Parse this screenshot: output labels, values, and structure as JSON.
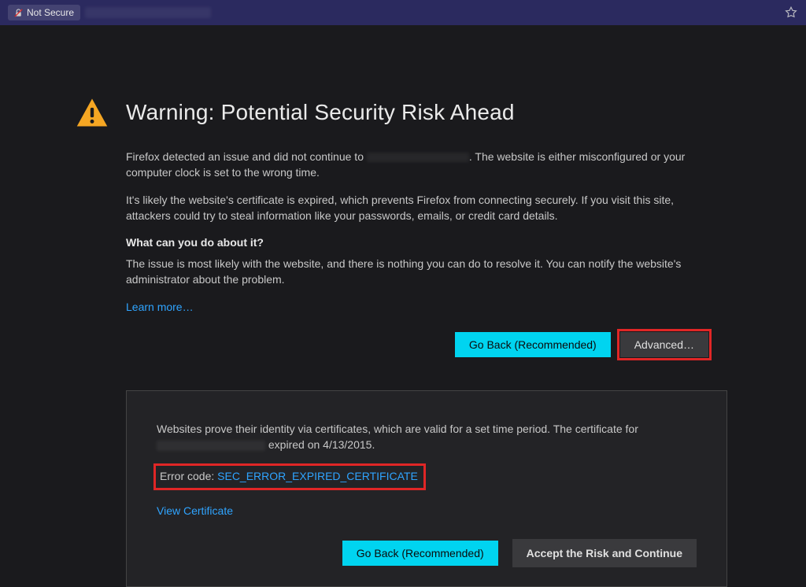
{
  "address_bar": {
    "not_secure_label": "Not Secure"
  },
  "page": {
    "title": "Warning: Potential Security Risk Ahead",
    "para1_before": "Firefox detected an issue and did not continue to ",
    "para1_after": ". The website is either misconfigured or your computer clock is set to the wrong time.",
    "para2": "It's likely the website's certificate is expired, which prevents Firefox from connecting securely. If you visit this site, attackers could try to steal information like your passwords, emails, or credit card details.",
    "subhead": "What can you do about it?",
    "para3": "The issue is most likely with the website, and there is nothing you can do to resolve it. You can notify the website's administrator about the problem.",
    "learn_more": "Learn more…",
    "go_back_label": "Go Back (Recommended)",
    "advanced_label": "Advanced…"
  },
  "panel": {
    "text_before": "Websites prove their identity via certificates, which are valid for a set time period. The certificate for ",
    "text_after": " expired on 4/13/2015.",
    "error_code_label": "Error code: ",
    "error_code": "SEC_ERROR_EXPIRED_CERTIFICATE",
    "view_cert": "View Certificate",
    "go_back_label": "Go Back (Recommended)",
    "accept_label": "Accept the Risk and Continue"
  }
}
